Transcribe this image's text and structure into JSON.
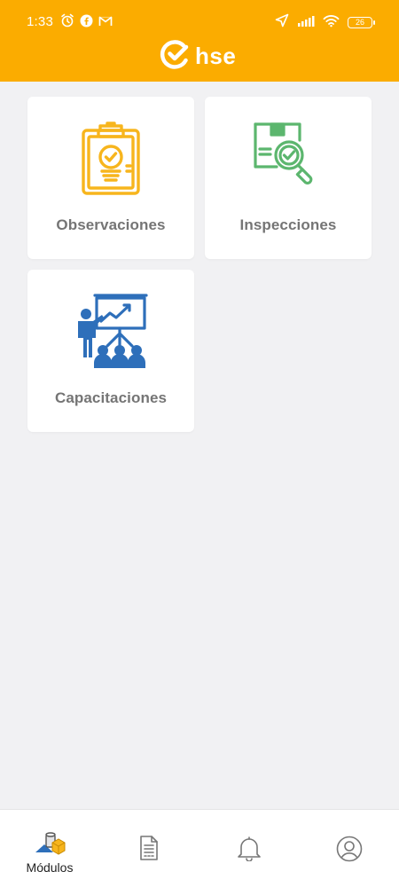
{
  "status_bar": {
    "time": "1:33",
    "battery": "26"
  },
  "header": {
    "brand": "hse"
  },
  "modules": [
    {
      "label": "Observaciones",
      "icon": "clipboard-check-icon"
    },
    {
      "label": "Inspecciones",
      "icon": "inspection-search-icon"
    },
    {
      "label": "Capacitaciones",
      "icon": "training-presentation-icon"
    }
  ],
  "colors": {
    "header": "#fbac00",
    "observaciones_icon": "#f7b51d",
    "inspecciones_icon": "#5cb66e",
    "capacitaciones_icon": "#2e6fba",
    "label": "#757575"
  },
  "bottom_nav": {
    "items": [
      {
        "label": "Módulos",
        "icon": "modules-icon",
        "active": true
      },
      {
        "label": "",
        "icon": "document-icon"
      },
      {
        "label": "",
        "icon": "bell-icon"
      },
      {
        "label": "",
        "icon": "user-profile-icon"
      }
    ]
  }
}
